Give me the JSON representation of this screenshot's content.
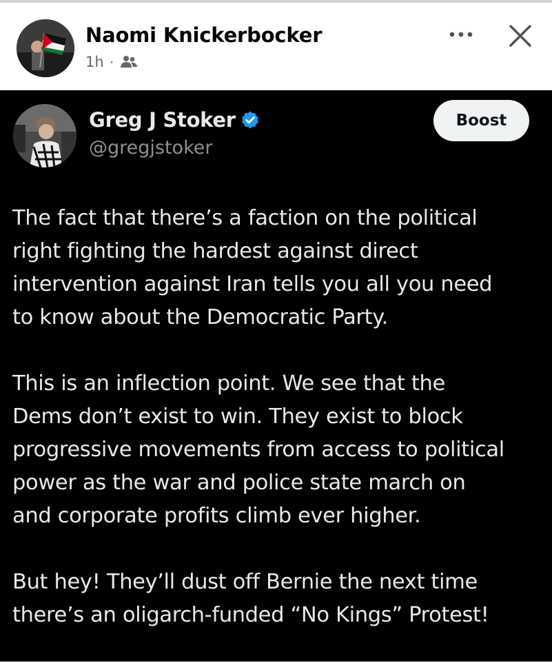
{
  "fb_post": {
    "author": "Naomi Knickerbocker",
    "time": "1h",
    "separator": "·",
    "icons": {
      "avatar": "profile-photo-with-flag",
      "audience": "friends-icon",
      "more": "more-dots-icon",
      "close": "close-x-icon"
    }
  },
  "tweet": {
    "author_name": "Greg J Stoker",
    "handle": "@gregjstoker",
    "boost_label": "Boost",
    "verified_color": "#1d9bf0",
    "paragraphs": [
      {
        "lines": [
          "The fact that there’s a faction on the political",
          "right fighting the hardest against direct",
          "intervention against Iran tells you all you need",
          "to know about the Democratic Party."
        ]
      },
      {
        "lines": [
          "This is an inflection point. We see that the",
          "Dems don’t exist to win. They exist to block",
          "progressive movements from access to political",
          "power as the war and police state march on",
          "and corporate profits climb ever higher."
        ]
      },
      {
        "lines": [
          "But hey! They’ll dust off Bernie the next time",
          "there’s an oligarch-funded “No Kings” Protest!"
        ]
      }
    ]
  },
  "colors": {
    "tweet_background": "#000000",
    "tweet_text": "#e7e9ea",
    "handle_text": "#8b9096",
    "fb_name": "#050505",
    "fb_meta": "#65676b"
  }
}
